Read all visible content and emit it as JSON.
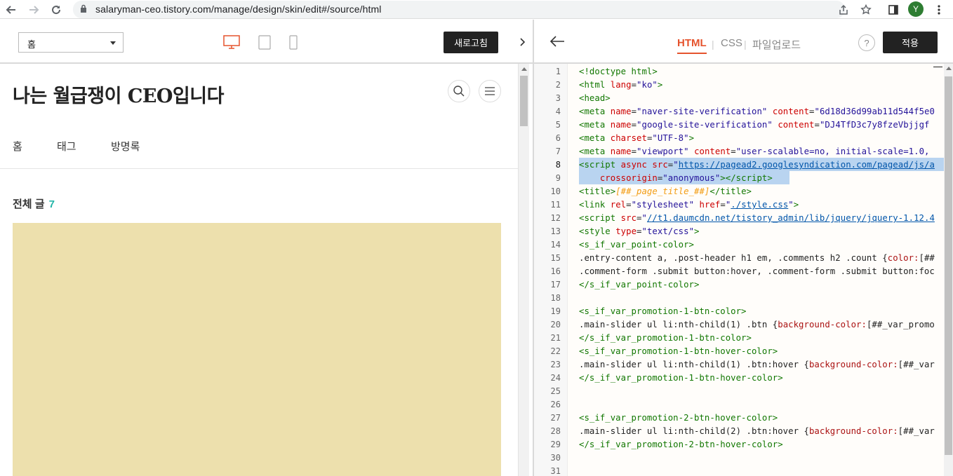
{
  "browser": {
    "url": "salaryman-ceo.tistory.com/manage/design/skin/edit#/source/html",
    "profile_initial": "Y",
    "icons": [
      "back-icon",
      "forward-icon",
      "reload-icon",
      "lock-icon",
      "share-icon",
      "star-icon",
      "sidepanel-icon",
      "kebab-icon"
    ]
  },
  "left": {
    "page_select": "홈",
    "refresh_button": "새로고침",
    "blog_title": "나는 월급쟁이 CEO입니다",
    "nav": [
      "홈",
      "태그",
      "방명록"
    ],
    "post_label": "전체 글",
    "post_count": "7",
    "thumbnail_color": "#ede0ad"
  },
  "right": {
    "tabs": [
      "HTML",
      "CSS",
      "파일업로드"
    ],
    "separator": "|",
    "help": "?",
    "apply_button": "적용",
    "accent": "#e5532d"
  },
  "code": {
    "line_numbers": [
      "1",
      "2",
      "3",
      "4",
      "5",
      "6",
      "7",
      "8",
      "9",
      "10",
      "11",
      "12",
      "13",
      "14",
      "15",
      "16",
      "17",
      "18",
      "19",
      "20",
      "21",
      "22",
      "23",
      "24",
      "25",
      "26",
      "27",
      "28",
      "29",
      "30",
      "31"
    ],
    "l4_content_val": "\"6d18d36d99ab11d544f5e0",
    "l5_content_val": "\"DJ4TfD3c7y8fzeVbjjgf",
    "l7_content_val": "\"user-scalable=no, initial-scale=1.0,",
    "l8_url": "https://pagead2.googlesyndication.com/pagead/js/a",
    "l10_var": "[##_page_title_##]",
    "l11_href": "./style.css",
    "l12_src": "//t1.daumcdn.net/tistory_admin/lib/jquery/jquery-1.12.4",
    "l15_text": ".entry-content a, .post-header h1 em, .comments h2 .count {",
    "l15_prop": "color:",
    "l15_tail": "[##",
    "l16_text": ".comment-form .submit button:hover, .comment-form .submit button:foc",
    "l20_sel": ".main-slider ul li:nth-child(1) .btn {",
    "l20_prop": "background-color:",
    "l20_tail": "[##_var_promo",
    "l23_sel": ".main-slider ul li:nth-child(1) .btn:hover {",
    "l23_prop": "background-color:",
    "l23_tail": "[##_var",
    "l28_sel": ".main-slider ul li:nth-child(2) .btn:hover {",
    "l28_prop": "background-color:",
    "l28_tail": "[##_var"
  }
}
